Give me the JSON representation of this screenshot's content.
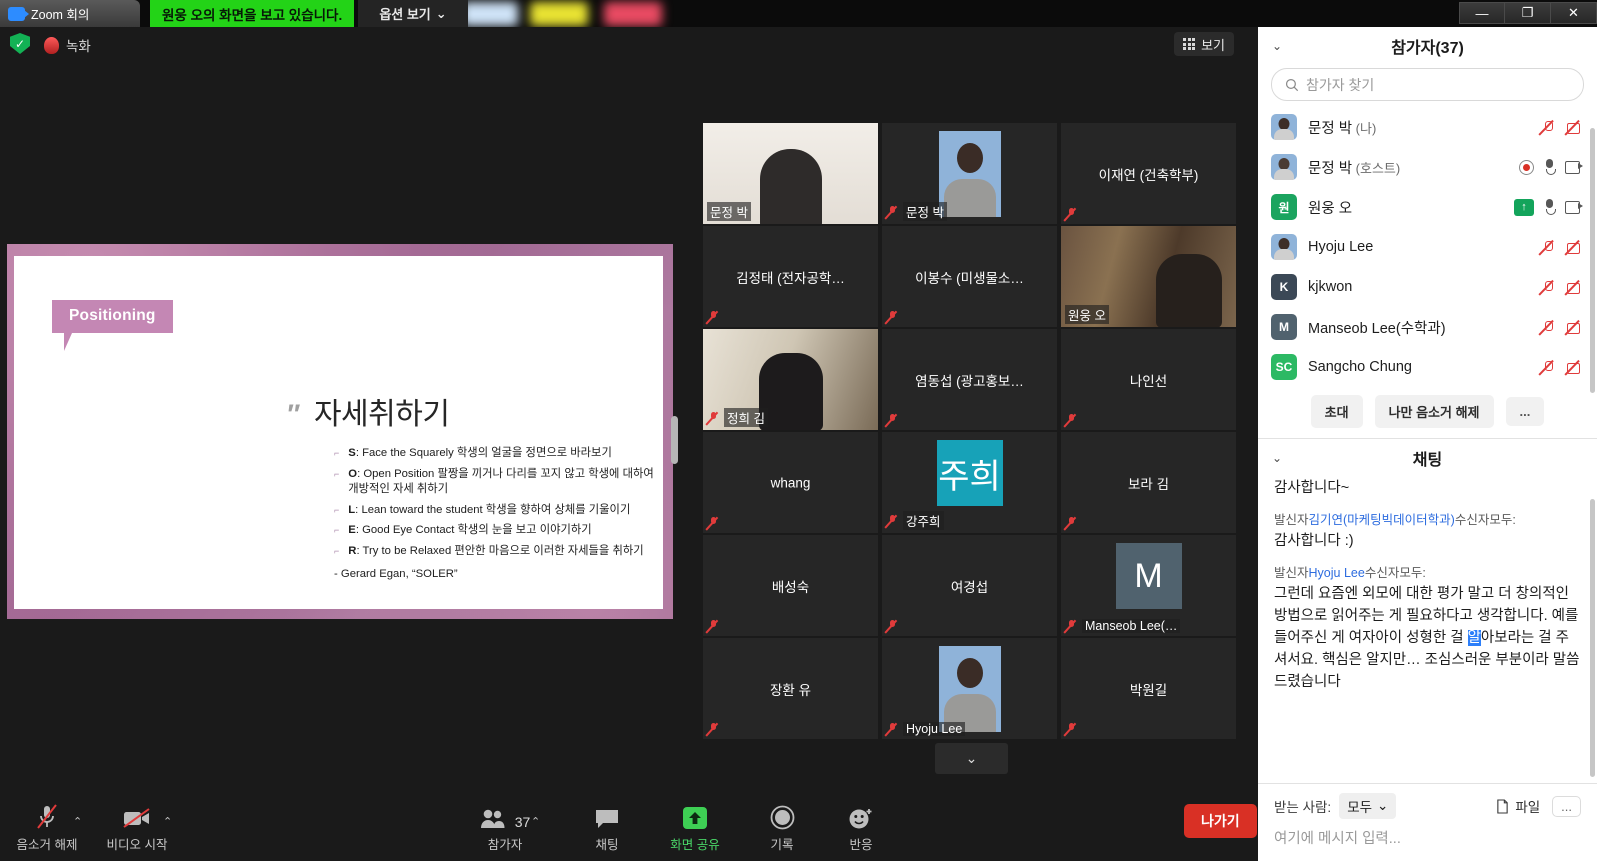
{
  "titlebar": {
    "app_tab": "Zoom 회의",
    "sharing_banner": "원웅 오의 화면을 보고 있습니다.",
    "options_label": "옵션 보기",
    "chevron": "⌄",
    "minimize": "—",
    "maximize": "❐",
    "close": "✕"
  },
  "meetbar": {
    "shield_icon": "✓",
    "recording_label": "녹화",
    "view_label": "보기"
  },
  "slide": {
    "badge": "Positioning",
    "quote_mark": "″",
    "title": "자세취하기",
    "bullets": [
      {
        "key": "S",
        "text": ": Face the Squarely 학생의 얼굴을 정면으로 바라보기"
      },
      {
        "key": "O",
        "text": ": Open  Position 팔짱을 끼거나 다리를 꼬지 않고 학생에 대하여 개방적인 자세 취하기"
      },
      {
        "key": "L",
        "text": ": Lean toward the student 학생을 향하여 상체를 기울이기"
      },
      {
        "key": "E",
        "text": ": Good Eye Contact 학생의 눈을 보고 이야기하기"
      },
      {
        "key": "R",
        "text": ": Try to be Relaxed  편안한 마음으로 이러한 자세들을 취하기"
      }
    ],
    "credit": "- Gerard Egan, “SOLER”"
  },
  "tiles": [
    {
      "name": "문정 박",
      "pos": "bottom",
      "muted": false,
      "video": "photo-man",
      "active": false
    },
    {
      "name": "문정 박",
      "pos": "bottom",
      "muted": true,
      "video": "photo-woman",
      "active": false
    },
    {
      "name": "이재연 (건축학부)",
      "pos": "center",
      "muted": true,
      "video": "none",
      "active": false
    },
    {
      "name": "김정태 (전자공학…",
      "pos": "center",
      "muted": true,
      "video": "none",
      "active": false
    },
    {
      "name": "이봉수 (미생물소…",
      "pos": "center",
      "muted": true,
      "video": "none",
      "active": false
    },
    {
      "name": "원웅 오",
      "pos": "bottom",
      "muted": false,
      "video": "photo-library",
      "active": true
    },
    {
      "name": "정희 김",
      "pos": "bottom",
      "muted": true,
      "video": "photo-shelf",
      "active": false
    },
    {
      "name": "염동섭 (광고홍보…",
      "pos": "center",
      "muted": true,
      "video": "none",
      "active": false
    },
    {
      "name": "나인선",
      "pos": "center",
      "muted": true,
      "video": "none",
      "active": false
    },
    {
      "name": "whang",
      "pos": "center",
      "muted": true,
      "video": "none",
      "active": false
    },
    {
      "name": "강주희",
      "pos": "bottom",
      "muted": true,
      "video": "avatar-teal",
      "avatar_text": "주희",
      "avatar_color": "#17a2b8",
      "active": false
    },
    {
      "name": "보라 김",
      "pos": "center",
      "muted": true,
      "video": "none",
      "active": false
    },
    {
      "name": "배성숙",
      "pos": "center",
      "muted": true,
      "video": "none",
      "active": false
    },
    {
      "name": "여경섭",
      "pos": "center",
      "muted": true,
      "video": "none",
      "active": false
    },
    {
      "name": "Manseob Lee(…",
      "pos": "bottom",
      "muted": true,
      "video": "avatar-slate",
      "avatar_text": "M",
      "avatar_color": "#50626e",
      "active": false
    },
    {
      "name": "장환 유",
      "pos": "center",
      "muted": true,
      "video": "none",
      "active": false
    },
    {
      "name": "Hyoju Lee",
      "pos": "bottom",
      "muted": true,
      "video": "photo-woman",
      "active": false
    },
    {
      "name": "박원길",
      "pos": "center",
      "muted": true,
      "video": "none",
      "active": false
    }
  ],
  "tile_scroll_icon": "⌄",
  "toolbar": {
    "items": [
      {
        "name": "unmute",
        "label": "음소거 해제",
        "icon": "mic-off-icon",
        "has_caret": true,
        "accent": "#c8c8c8"
      },
      {
        "name": "start-video",
        "label": "비디오 시작",
        "icon": "video-off-icon",
        "has_caret": true,
        "accent": "#c8c8c8"
      },
      {
        "name": "participants",
        "label": "참가자",
        "icon": "participants-icon",
        "badge": "37",
        "has_caret": true,
        "accent": "#c8c8c8"
      },
      {
        "name": "chat",
        "label": "채팅",
        "icon": "chat-icon",
        "has_caret": false,
        "accent": "#c8c8c8"
      },
      {
        "name": "share-screen",
        "label": "화면 공유",
        "icon": "share-screen-icon",
        "has_caret": false,
        "accent": "#4ad668"
      },
      {
        "name": "record",
        "label": "기록",
        "icon": "record-icon",
        "has_caret": false,
        "accent": "#c8c8c8"
      },
      {
        "name": "reactions",
        "label": "반응",
        "icon": "reactions-icon",
        "has_caret": false,
        "accent": "#c8c8c8"
      }
    ],
    "leave_label": "나가기"
  },
  "participants_panel": {
    "title": "참가자(37)",
    "chevron": "⌄",
    "search_placeholder": "참가자 찾기",
    "search_value": "",
    "rows": [
      {
        "name": "문정 박",
        "suffix": " (나)",
        "avatar_type": "photo-woman",
        "avatar_text": "",
        "avatar_color": "#8fb3d9",
        "icons": [
          "mic-red",
          "cam-red"
        ]
      },
      {
        "name": "문정 박",
        "suffix": " (호스트)",
        "avatar_type": "photo-man",
        "avatar_text": "",
        "avatar_color": "#8fb3d9",
        "icons": [
          "rec-ind",
          "mic-gray",
          "cam-gray"
        ]
      },
      {
        "name": "원웅 오",
        "suffix": "",
        "avatar_type": "initial",
        "avatar_text": "원",
        "avatar_color": "#1ba45f",
        "icons": [
          "up-badge",
          "mic-gray",
          "cam-gray"
        ]
      },
      {
        "name": "Hyoju Lee",
        "suffix": "",
        "avatar_type": "photo-woman",
        "avatar_text": "",
        "avatar_color": "#8fb3d9",
        "icons": [
          "mic-red",
          "cam-red"
        ]
      },
      {
        "name": "kjkwon",
        "suffix": "",
        "avatar_type": "initial",
        "avatar_text": "K",
        "avatar_color": "#3b4856",
        "icons": [
          "mic-red",
          "cam-red"
        ]
      },
      {
        "name": "Manseob Lee(수학과)",
        "suffix": "",
        "avatar_type": "initial",
        "avatar_text": "M",
        "avatar_color": "#50626e",
        "icons": [
          "mic-red",
          "cam-red"
        ]
      },
      {
        "name": "Sangcho Chung",
        "suffix": "",
        "avatar_type": "initial",
        "avatar_text": "SC",
        "avatar_color": "#2cb964",
        "icons": [
          "mic-red",
          "cam-red"
        ]
      }
    ],
    "buttons": [
      {
        "name": "invite",
        "label": "초대"
      },
      {
        "name": "unmute-me",
        "label": "나만 음소거 해제"
      },
      {
        "name": "more",
        "label": "..."
      }
    ]
  },
  "chat_panel": {
    "title": "채팅",
    "chevron": "⌄",
    "messages": [
      {
        "header_prefix": "",
        "sender": "",
        "header_suffix": "",
        "body": "감사합니다~",
        "clipped": true
      },
      {
        "header_prefix": "발신자",
        "sender": "김기연(마케팅빅데이터학과)",
        "header_suffix": "수신자모두:",
        "body": "감사합니다 :)",
        "clipped": false
      },
      {
        "header_prefix": "발신자",
        "sender": "Hyoju Lee",
        "header_suffix": "수신자모두:",
        "body_before": "그런데 요즘엔 외모에 대한 평가 말고 더 창의적인 방법으로 읽어주는 게 필요하다고 생각합니다. 예를 들어주신 게 여자아이 성형한 걸 ",
        "body_highlight": "알",
        "body_after": "아보라는 걸 주셔서요. 핵심은 알지만… 조심스러운 부분이라 말씀드렸습니다",
        "clipped": false
      }
    ],
    "footer": {
      "to_label": "받는 사람:",
      "to_value": "모두",
      "to_chevron": "⌄",
      "file_label": "파일",
      "more_label": "...",
      "input_placeholder": "여기에 메시지 입력..."
    }
  }
}
